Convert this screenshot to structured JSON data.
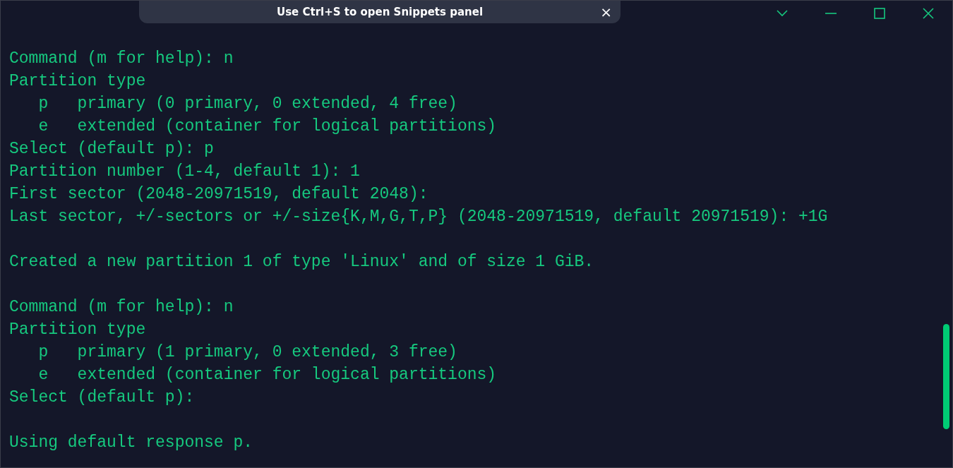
{
  "snippets_banner": {
    "text": "Use Ctrl+S to open Snippets panel",
    "close": "×"
  },
  "terminal": {
    "blocks": [
      [
        "Command (m for help): n",
        "Partition type",
        "   p   primary (0 primary, 0 extended, 4 free)",
        "   e   extended (container for logical partitions)",
        "Select (default p): p",
        "Partition number (1-4, default 1): 1",
        "First sector (2048-20971519, default 2048):",
        "Last sector, +/-sectors or +/-size{K,M,G,T,P} (2048-20971519, default 20971519): +1G"
      ],
      [
        "Created a new partition 1 of type 'Linux' and of size 1 GiB."
      ],
      [
        "Command (m for help): n",
        "Partition type",
        "   p   primary (1 primary, 0 extended, 3 free)",
        "   e   extended (container for logical partitions)",
        "Select (default p):"
      ],
      [
        "Using default response p."
      ]
    ]
  }
}
